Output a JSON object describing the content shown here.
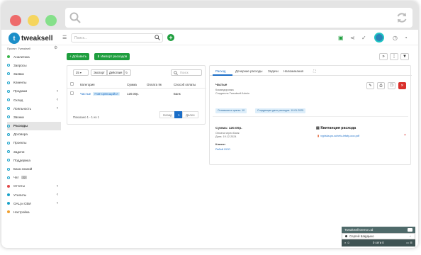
{
  "app": {
    "logo_text": "tweaksell",
    "logo_mark": "t",
    "search_placeholder": "Поиск...",
    "project_label": "Проект: Tweaksell",
    "accent": "#1a6dc7",
    "green": "#1e9e3e"
  },
  "sidebar": {
    "items": [
      {
        "label": "Аналитика",
        "icon": "chart-icon"
      },
      {
        "label": "Запросы",
        "icon": "inquiry-icon"
      },
      {
        "label": "Заявки",
        "icon": "order-icon"
      },
      {
        "label": "Клиенты",
        "icon": "clients-icon"
      },
      {
        "label": "Продажи",
        "icon": "sales-icon",
        "expand": true
      },
      {
        "label": "Склад",
        "icon": "warehouse-icon",
        "expand": true
      },
      {
        "label": "Лояльность",
        "icon": "loyalty-icon",
        "expand": true
      },
      {
        "label": "Звонки",
        "icon": "phone-icon"
      },
      {
        "label": "Расходы",
        "icon": "expenses-icon",
        "active": true
      },
      {
        "label": "Договора",
        "icon": "contracts-icon"
      },
      {
        "label": "Проекты",
        "icon": "projects-icon"
      },
      {
        "label": "Задачи",
        "icon": "tasks-icon"
      },
      {
        "label": "Поддержка",
        "icon": "support-icon"
      },
      {
        "label": "База знаний",
        "icon": "knowledge-icon"
      },
      {
        "label": "Чат",
        "icon": "chat-icon",
        "tag": "22"
      },
      {
        "label": "Отчеты",
        "icon": "reports-icon",
        "expand": true
      },
      {
        "label": "Утилиты",
        "icon": "utilities-icon",
        "expand": true
      },
      {
        "label": "ОАЦ и СВИ",
        "icon": "oac-icon",
        "expand": true
      },
      {
        "label": "Настройка",
        "icon": "settings-icon"
      }
    ]
  },
  "toolbar": {
    "add_label": "+ Добавить",
    "import_label": "⬇ Импорт расходов",
    "icons": [
      "collapse-icon",
      "more-icon",
      "filter-icon"
    ]
  },
  "list": {
    "page_size": "25",
    "export_label": "Экспорт",
    "actions_label": "Действия",
    "search_placeholder": "Поиск",
    "columns": [
      "Категория",
      "Сумма",
      "Оплата №",
      "Способ оплаты"
    ],
    "rows": [
      {
        "category": "Частые",
        "badge": "Повторяющийся",
        "amount": "120.00р.",
        "payment_no": "",
        "method": "Банк"
      }
    ],
    "showing": "Показано 1 - 1 из 1",
    "prev_label": "Назад",
    "current_page": "1",
    "next_label": "Далее"
  },
  "detail": {
    "tabs": [
      "Расход",
      "Дочерние расходы",
      "Задачи",
      "Напоминания"
    ],
    "category": "Частые",
    "subtitle_1": "Командировка",
    "subtitle_2": "Создатель Tweaksell Admin",
    "cycles_chip": "Оставшиеся циклы: 10",
    "next_date_chip": "Следующая дата расходов: 19.01.2025",
    "amount_line": "Сумма: 120.00р.",
    "payment_line": "Оплата через Банк",
    "date_line": "Дата: 19.12.2024",
    "client_label": "Клиент",
    "client_name": "Рябой ООО",
    "receipt_title": "Квитанция расхода",
    "file_name": "vypiska-po-schetu-ietaty-ooo.pdf"
  },
  "chat": {
    "company": "TweakSell Demo Ltd",
    "user": "Сергей Шардыко",
    "online": "0 сети 0"
  }
}
